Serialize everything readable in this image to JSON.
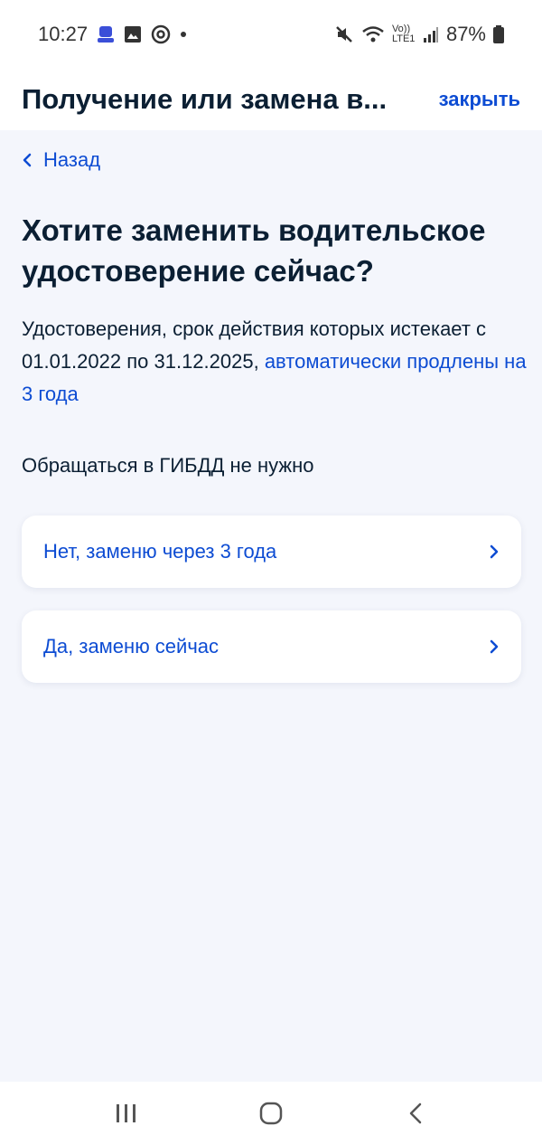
{
  "status_bar": {
    "time": "10:27",
    "battery": "87%",
    "network": "Vo)) LTE1"
  },
  "header": {
    "title": "Получение или замена в...",
    "close_label": "закрыть"
  },
  "nav": {
    "back_label": "Назад"
  },
  "main": {
    "title": "Хотите заменить водительское удостоверение сейчас?",
    "info_text": "Удостоверения, срок действия которых истекает с 01.01.2022 по 31.12.2025, ",
    "info_link": "автоматически продлены на 3 года",
    "note": "Обращаться в ГИБДД не нужно",
    "options": [
      {
        "label": "Нет, заменю через 3 года"
      },
      {
        "label": "Да, заменю сейчас"
      }
    ]
  },
  "colors": {
    "accent": "#0d4cd3",
    "background": "#f4f6fc",
    "text": "#0b1f33"
  }
}
